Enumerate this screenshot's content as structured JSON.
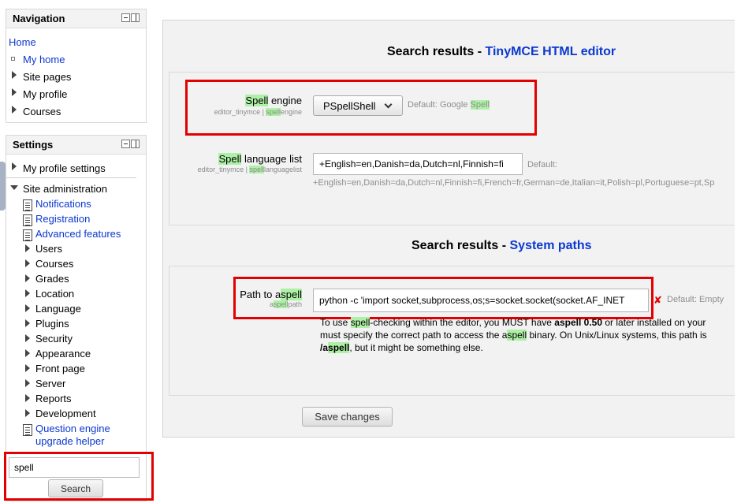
{
  "navigation": {
    "title": "Navigation",
    "home": "Home",
    "items": [
      "My home",
      "Site pages",
      "My profile",
      "Courses"
    ]
  },
  "settings": {
    "title": "Settings",
    "my_profile_settings": "My profile settings",
    "site_admin": "Site administration",
    "links": [
      "Notifications",
      "Registration",
      "Advanced features"
    ],
    "categories": [
      "Users",
      "Courses",
      "Grades",
      "Location",
      "Language",
      "Plugins",
      "Security",
      "Appearance",
      "Front page",
      "Server",
      "Reports",
      "Development"
    ],
    "question_engine_line1": "Question engine",
    "question_engine_line2": "upgrade helper"
  },
  "search": {
    "value": "spell",
    "button": "Search"
  },
  "results1": {
    "prefix": "Search results - ",
    "link": "TinyMCE HTML editor"
  },
  "spell_engine": {
    "label_hl": "Spell",
    "label_rest": " engine",
    "sub_prefix": "editor_tinymce | ",
    "sub_hl": "spell",
    "sub_rest": "engine",
    "selected": "PSpellShell",
    "default_prefix": "Default: Google ",
    "default_hl": "Spell"
  },
  "spell_language": {
    "label_hl": "Spell",
    "label_rest": " language list",
    "sub_prefix": "editor_tinymce | ",
    "sub_hl": "spell",
    "sub_rest": "languagelist",
    "value": "+English=en,Danish=da,Dutch=nl,Finnish=fi",
    "default_label": "Default:",
    "default_value": "+English=en,Danish=da,Dutch=nl,Finnish=fi,French=fr,German=de,Italian=it,Polish=pl,Portuguese=pt,Sp"
  },
  "results2": {
    "prefix": "Search results - ",
    "link": "System paths"
  },
  "aspell": {
    "label_prefix": "Path to a",
    "label_hl": "spell",
    "sub_prefix": "a",
    "sub_hl": "spell",
    "sub_rest": "path",
    "value": "python -c 'import socket,subprocess,os;s=socket.socket(socket.AF_INET",
    "error_mark": "✘",
    "default": "Default: Empty",
    "desc1_a": "To use ",
    "desc1_hl": "spell",
    "desc1_b": "-checking within the editor, you MUST have ",
    "desc1_bold": "aspell 0.50",
    "desc1_c": " or later installed on your",
    "desc2_a": "must specify the correct path to access the a",
    "desc2_hl": "spell",
    "desc2_b": " binary. On Unix/Linux systems, this path is",
    "desc3_bold_a": "/a",
    "desc3_bold_hl": "spell",
    "desc3_rest": ", but it might be something else."
  },
  "save_button": "Save changes"
}
